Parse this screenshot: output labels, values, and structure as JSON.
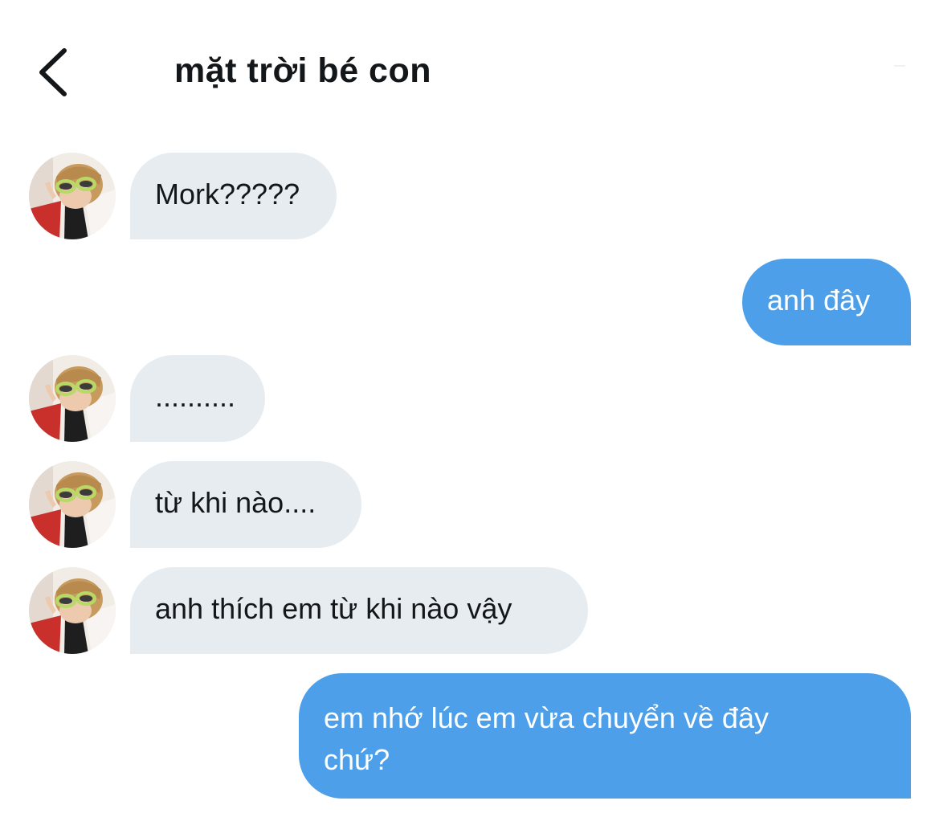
{
  "header": {
    "title": "mặt trời bé con"
  },
  "messages": [
    {
      "sender": "contact",
      "text": "Mork?????"
    },
    {
      "sender": "me",
      "text": "anh đây"
    },
    {
      "sender": "contact",
      "text": ".........."
    },
    {
      "sender": "contact",
      "text": "từ khi nào...."
    },
    {
      "sender": "contact",
      "text": "anh thích em từ khi nào vậy"
    },
    {
      "sender": "me",
      "text": "em nhớ lúc em vừa chuyển về đây chứ?",
      "lines": [
        "em nhớ lúc em vừa chuyển về đây",
        "chứ?"
      ]
    }
  ],
  "colors": {
    "incoming_bubble": "#e6ecf0",
    "outgoing_bubble": "#4e9fe9",
    "text": "#14171a"
  },
  "icons": {
    "back": "chevron-left-icon"
  }
}
